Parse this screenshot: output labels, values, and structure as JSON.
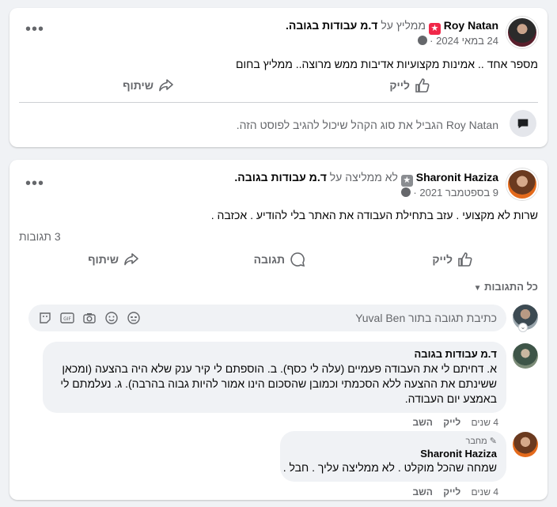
{
  "post1": {
    "author": "Roy Natan",
    "recommend_text": "ממליץ על",
    "page_name": "ד.מ עבודות בגובה",
    "date": "24 במאי 2024",
    "body": "מספר אחד .. אמינות מקצועיות אדיבות ממש מרוצה.. ממליץ בחום",
    "like_label": "לייק",
    "share_label": "שיתוף",
    "restricted_author": "Roy Natan",
    "restricted_text": "הגביל את סוג הקהל שיכול להגיב לפוסט הזה."
  },
  "post2": {
    "author": "Sharonit Haziza",
    "recommend_text": "לא ממליצה על",
    "page_name": "ד.מ עבודות בגובה",
    "date": "9 בספטמבר 2021",
    "body": "שרות לא מקצועי . עזב בתחילת העבודה את האתר בלי להודיע . אכזבה .",
    "comments_count": "3 תגובות",
    "like_label": "לייק",
    "comment_label": "תגובה",
    "share_label": "שיתוף",
    "all_comments": "כל התגובות",
    "composer_placeholder": "כתיבת תגובה בתור Yuval Ben",
    "comments": [
      {
        "author": "ד.מ עבודות בגובה",
        "text": "א. דחיתם לי את העבודה פעמיים (עלה לי כסף). ב. הוספתם לי קיר ענק שלא היה בהצעה (ומכאן ששינתם את ההצעה ללא הסכמתי וכמובן שהסכום הינו אמור להיות גבוה בהרבה). ג. נעלמתם לי באמצע יום העבודה.",
        "time": "4 שנים",
        "like": "לייק",
        "reply": "השב"
      },
      {
        "badge": "מחבר",
        "author": "Sharonit Haziza",
        "text": "שמחה שהכל מוקלט . לא ממליצה עליך . חבל .",
        "time": "4 שנים",
        "like": "לייק",
        "reply": "השב"
      }
    ]
  }
}
